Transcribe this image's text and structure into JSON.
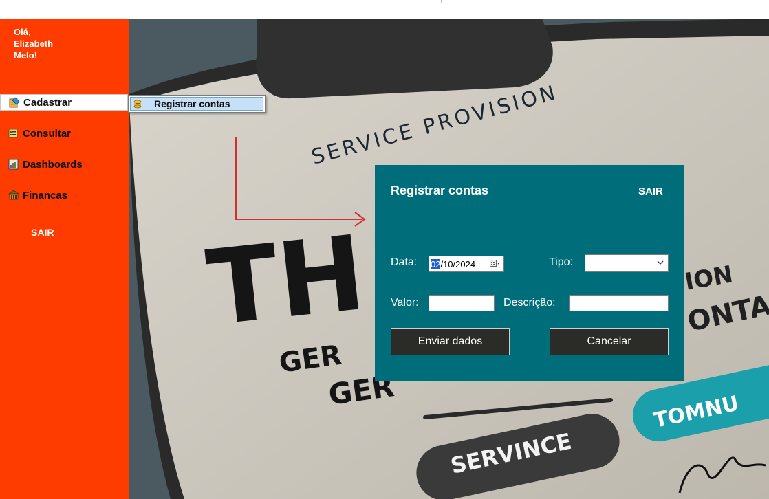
{
  "sidebar": {
    "greeting": "Olá,\nElizabeth\nMelo!",
    "items": [
      {
        "label": "Cadastrar",
        "icon": "register-icon"
      },
      {
        "label": "Consultar",
        "icon": "search-list-icon"
      },
      {
        "label": "Dashboards",
        "icon": "chart-icon"
      },
      {
        "label": "Financas",
        "icon": "bank-icon"
      }
    ],
    "sair_label": "SAIR"
  },
  "submenu": {
    "item_label": "Registrar contas",
    "icon": "coins-icon"
  },
  "background": {
    "texts": [
      "SERVICE PROVISION",
      "TH",
      "ION",
      "ONTA",
      "GER",
      "GER",
      "SERVINCE",
      "TOMNU"
    ]
  },
  "dialog": {
    "title": "Registrar contas",
    "sair_label": "SAIR",
    "data_label": "Data:",
    "date_selected": "02",
    "date_rest": "/10/2024",
    "tipo_label": "Tipo:",
    "tipo_value": "",
    "valor_label": "Valor:",
    "valor_value": "",
    "descricao_label": "Descrição:",
    "descricao_value": "",
    "send_button": "Enviar dados",
    "cancel_button": "Cancelar"
  },
  "colors": {
    "sidebar": "#ff3c00",
    "dialog": "#006e7a",
    "button": "#2b2b27",
    "submenu_highlight": "#c6e1f7"
  }
}
